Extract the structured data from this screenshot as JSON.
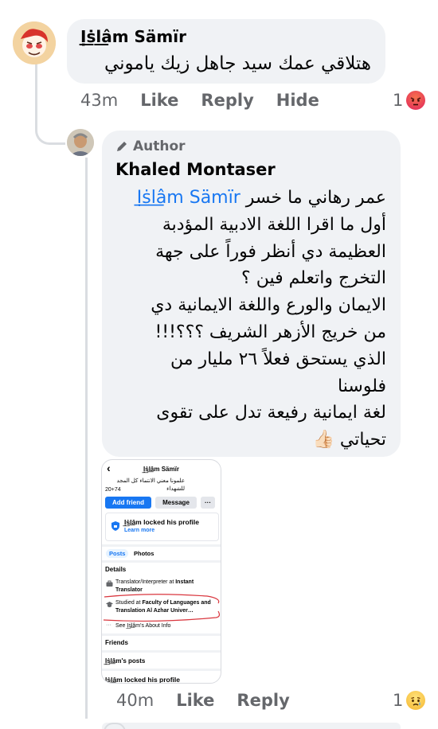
{
  "comment1": {
    "author": "Ị͟ṡl͟âm Sämïr",
    "text": "هتلاقي عمك سيد جاهل زيك ياموني",
    "time": "43m",
    "like": "Like",
    "reply": "Reply",
    "hide": "Hide",
    "reaction_count": "1"
  },
  "comment2": {
    "badge": "Author",
    "author": "Khaled Montaser",
    "mention": "Ị͟ṡl͟âm Sämïr",
    "line1": "عمر  رهاني ما خسر",
    "line2": "أول ما اقرا اللغة الادبية المؤدبة",
    "line3": "العظيمة دي أنظر فوراً على جهة",
    "line4": "التخرج واتعلم فين ؟",
    "line5": "الايمان والورع واللغة الايمانية دي",
    "line6": "من خريج الأزهر الشريف ؟؟؟!!!",
    "line7": "الذي يستحق فعلاً ٢٦ مليار من",
    "line8": "فلوسنا",
    "line9": "لغة ايمانية رفيعة  تدل على تقوى",
    "line10": "تحياتي",
    "thumb_emoji": "👍🏻",
    "time": "40m",
    "like": "Like",
    "reply": "Reply",
    "reaction_count": "1"
  },
  "attachment": {
    "back": "‹",
    "title": "Ị͟ṡl͟âm Sämïr",
    "bio_line1": "علمونا معني الانتماء كل المجد للشهداء",
    "bio_line2": "20+74",
    "add_friend": "Add friend",
    "message": "Message",
    "more": "···",
    "locked_title": "Ị͟ṡl͟âm locked his profile",
    "learn_more": "Learn more",
    "tab_posts": "Posts",
    "tab_photos": "Photos",
    "details": "Details",
    "detail1_prefix": "Translator/Interpreter at ",
    "detail1_bold": "Instant Translator",
    "detail2_prefix": "Studied at ",
    "detail2_bold": "Faculty of Languages and Translation Al Azhar Univer…",
    "about": "See Ị͟ṡl͟âm's About Info",
    "friends": "Friends",
    "posts": "Ị͟ṡl͟âm's posts",
    "bottom_locked": "Ị͟ṡl͟âm locked his profile"
  },
  "colors": {
    "bubble": "#f0f2f5",
    "link": "#1877f2",
    "meta": "#65676b",
    "annotation": "#d9363e"
  }
}
